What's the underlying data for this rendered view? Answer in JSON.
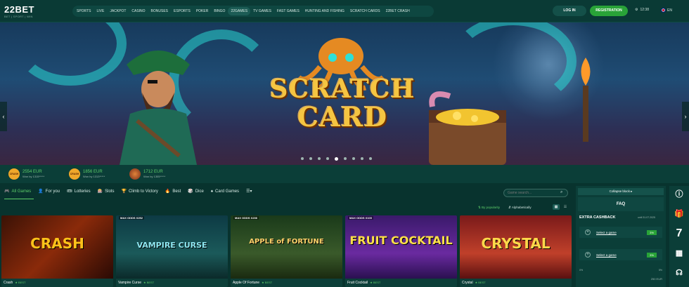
{
  "brand": {
    "name": "22BET",
    "tagline": "BET | SPORT | WIN"
  },
  "nav": [
    "SPORTS",
    "LIVE",
    "JACKPOT",
    "CASINO",
    "BONUSES",
    "ESPORTS",
    "POKER",
    "BINGO",
    "22GAMES",
    "TV GAMES",
    "FAST GAMES",
    "HUNTING AND FISHING",
    "SCRATCH CARDS",
    "22BET CRASH"
  ],
  "nav_active": "22GAMES",
  "auth": {
    "login": "LOG IN",
    "register": "REGISTRATION"
  },
  "clock": "12:38",
  "lang": "EN",
  "banner": {
    "line1": "SCRATCH",
    "line2": "CARD",
    "slides": 9,
    "active_slide": 4
  },
  "jackpots": [
    {
      "icon": "CRASH",
      "amount": "2554 EUR",
      "won_by": "Won by 1315*****"
    },
    {
      "icon": "CRASH",
      "amount": "1856 EUR",
      "won_by": "Won by 1313*****"
    },
    {
      "icon": "",
      "amount": "1712 EUR",
      "won_by": "Won by 1305*****"
    }
  ],
  "tabs": [
    "All Games",
    "For you",
    "Lotteries",
    "Slots",
    "Climb to Victory",
    "Best",
    "Dice",
    "Card Games"
  ],
  "search": {
    "placeholder": "Game search..."
  },
  "sort": {
    "popularity": "By popularity",
    "alpha": "Alphabetically"
  },
  "games": [
    {
      "name": "Crash",
      "badge": "BEST",
      "tag": "",
      "title": "CRASH"
    },
    {
      "name": "Vampire Curse",
      "badge": "BEST",
      "tag": "MAX ODDS X252",
      "title": "VAMPIRE CURSE"
    },
    {
      "name": "Apple Of Fortune",
      "badge": "BEST",
      "tag": "MAX ODDS X236",
      "title": "APPLE of FORTUNE"
    },
    {
      "name": "Fruit Cocktail",
      "badge": "BEST",
      "tag": "MAX ODDS X100",
      "title": "FRUIT COCKTAIL"
    },
    {
      "name": "Crystal",
      "badge": "BEST",
      "tag": "",
      "title": "CRYSTAL"
    }
  ],
  "panel": {
    "collapse": "Collapse block",
    "faq": "FAQ",
    "cashback_title": "EXTRA CASHBACK",
    "cashback_until": "until 31.07.2025",
    "rows": [
      {
        "label": "Select a game",
        "pct": "3%"
      },
      {
        "label": "Select a game",
        "pct": "3%"
      }
    ],
    "scale_min": "0%",
    "scale_max": "5%",
    "sum": "250 EUR"
  },
  "rail": {
    "seven": "7"
  }
}
